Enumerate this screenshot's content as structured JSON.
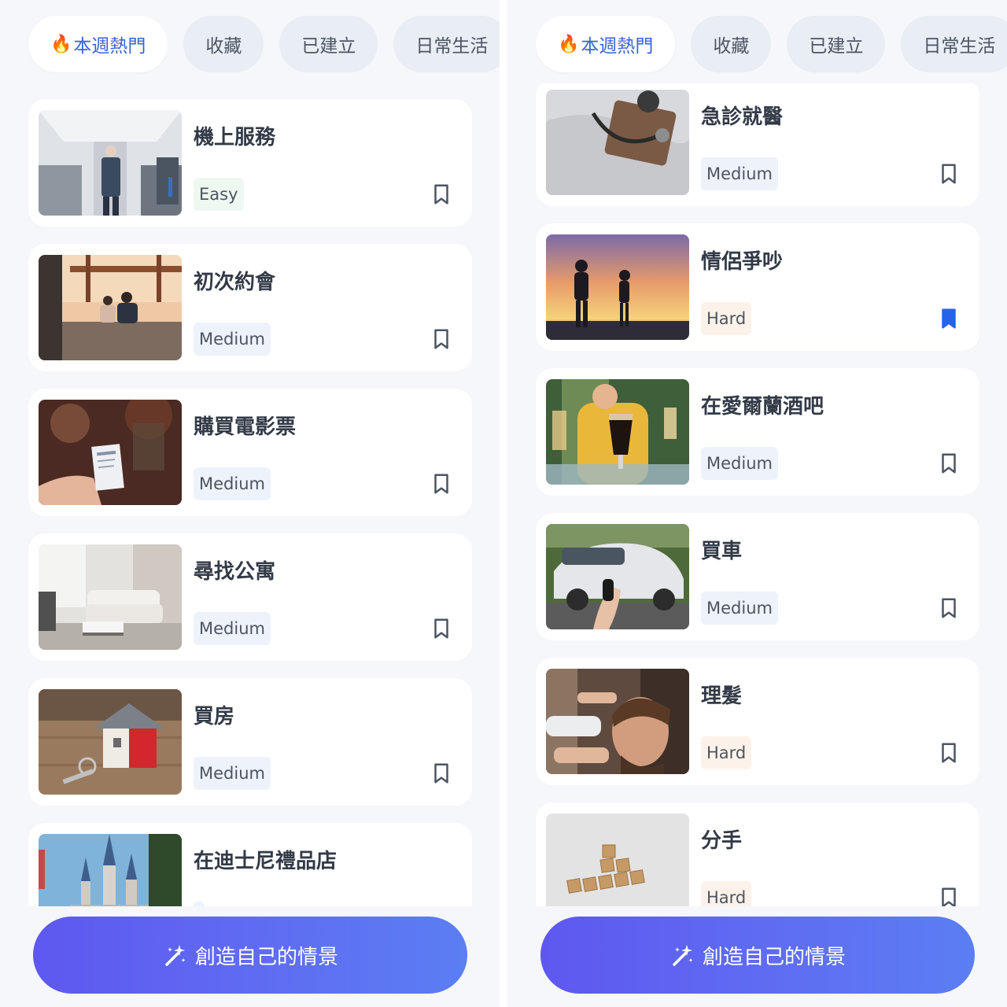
{
  "screens": [
    {
      "tabs": [
        {
          "label": "本週熱門",
          "active": true,
          "icon": "fire-icon"
        },
        {
          "label": "收藏"
        },
        {
          "label": "已建立"
        },
        {
          "label": "日常生活"
        }
      ],
      "cards": [
        {
          "title": "機上服務",
          "level": "Easy",
          "bookmarked": false,
          "image": "airplane-cabin-photo"
        },
        {
          "title": "初次約會",
          "level": "Medium",
          "bookmarked": false,
          "image": "couple-bridge-photo"
        },
        {
          "title": "購買電影票",
          "level": "Medium",
          "bookmarked": false,
          "image": "movie-ticket-photo"
        },
        {
          "title": "尋找公寓",
          "level": "Medium",
          "bookmarked": false,
          "image": "living-room-photo"
        },
        {
          "title": "買房",
          "level": "Medium",
          "bookmarked": false,
          "image": "house-keys-photo"
        },
        {
          "title": "在迪士尼禮品店",
          "level": "",
          "bookmarked": false,
          "image": "castle-photo"
        }
      ],
      "cta_label": "創造自己的情景"
    },
    {
      "tabs": [
        {
          "label": "本週熱門",
          "active": true,
          "icon": "fire-icon"
        },
        {
          "label": "收藏"
        },
        {
          "label": "已建立"
        },
        {
          "label": "日常生活"
        }
      ],
      "cards": [
        {
          "title": "急診就醫",
          "level": "Medium",
          "bookmarked": false,
          "image": "stethoscope-photo"
        },
        {
          "title": "情侶爭吵",
          "level": "Hard",
          "bookmarked": true,
          "image": "couple-sunset-photo"
        },
        {
          "title": "在愛爾蘭酒吧",
          "level": "Medium",
          "bookmarked": false,
          "image": "beer-glasses-photo"
        },
        {
          "title": "買車",
          "level": "Medium",
          "bookmarked": false,
          "image": "car-key-photo"
        },
        {
          "title": "理髮",
          "level": "Hard",
          "bookmarked": false,
          "image": "barber-photo"
        },
        {
          "title": "分手",
          "level": "Hard",
          "bookmarked": false,
          "image": "scrabble-sorry-photo"
        }
      ],
      "cta_label": "創造自己的情景"
    }
  ],
  "colors": {
    "accent": "#3b62d6",
    "bookmark_active": "#2563eb",
    "bookmark_inactive": "#4b5563",
    "cta_gradient_start": "#5e58f0",
    "cta_gradient_end": "#5b7ef3"
  }
}
